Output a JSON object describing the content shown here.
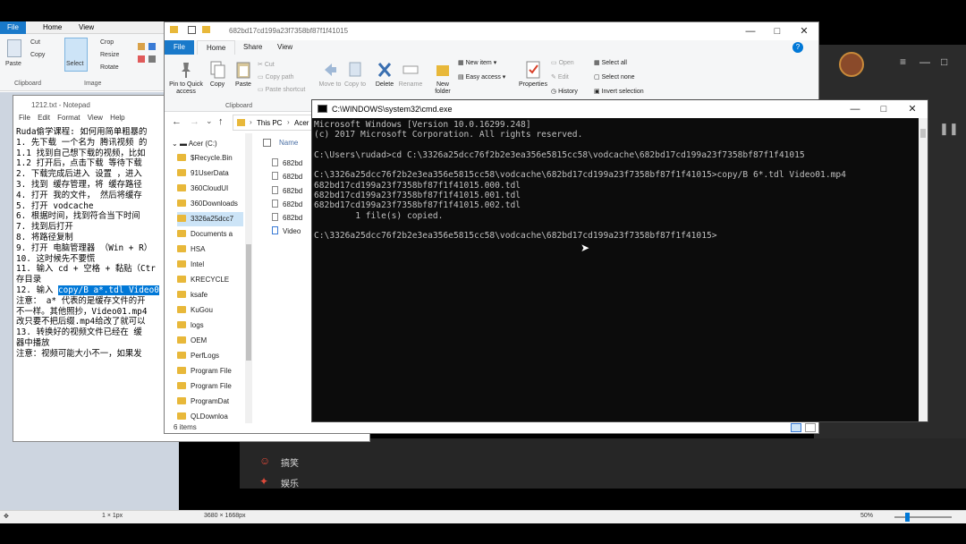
{
  "paint": {
    "tabs": [
      "File",
      "Home",
      "View"
    ],
    "ribbon": {
      "paste": "Paste",
      "cut": "Cut",
      "copy": "Copy",
      "select": "Select",
      "crop": "Crop",
      "resize": "Resize",
      "rotate": "Rotate",
      "group_clipboard": "Clipboard",
      "group_image": "Image"
    },
    "status": {
      "selection": "1 × 1px",
      "size": "3680 × 1668px",
      "zoom": "50%"
    }
  },
  "darkapp": {
    "item1": "搞笑",
    "item2": "娱乐"
  },
  "notepad": {
    "title": "1212.txt - Notepad",
    "menu": [
      "File",
      "Edit",
      "Format",
      "View",
      "Help"
    ],
    "lines": [
      "Ruda偷学课程: 如何用简单粗暴的",
      "",
      "1. 先下载 一个名为 腾讯视频 的",
      "1.1 找到自己想下载的视频，比如",
      "1.2 打开后，点击下载 等待下载",
      "",
      "",
      "2. 下载完成后进入 设置 ，进入",
      "3. 找到 缓存管理，将 缓存路径",
      "4. 打开 我的文件， 然后将缓存",
      "5. 打开 vodcache",
      "6. 根据时间，找到符合当下时间",
      "7. 找到后打开",
      "8. 将路径复制",
      "9. 打开 电脑管理器 （Win + R）",
      "10. 这时候先不要慌",
      "11. 输入 cd + 空格 + 黏贴（Ctr",
      "存目录"
    ],
    "line12_prefix": "12. 输入 ",
    "line12_highlight": "copy/B a*.tdl Video0",
    "lines_after": [
      "",
      "注意： a* 代表的是缓存文件的开",
      "不一样。其他照抄，Video01.mp4",
      "改只要不把后缀.mp4给改了就可以",
      "",
      "13. 转换好的视频文件已经在 缓",
      "器中播放",
      "",
      "注意：视频可能大小不一，如果发"
    ]
  },
  "explorer": {
    "title": "682bd17cd199a23f7358bf87f1f41015",
    "tabs": [
      "File",
      "Home",
      "Share",
      "View"
    ],
    "ribbon": {
      "pin": "Pin to Quick access",
      "copy": "Copy",
      "paste": "Paste",
      "cut": "Cut",
      "copy_path": "Copy path",
      "paste_shortcut": "Paste shortcut",
      "move_to": "Move to",
      "copy_to": "Copy to",
      "delete": "Delete",
      "rename": "Rename",
      "new_folder": "New folder",
      "new_item": "New item",
      "easy_access": "Easy access",
      "properties": "Properties",
      "open": "Open",
      "edit": "Edit",
      "history": "History",
      "select_all": "Select all",
      "select_none": "Select none",
      "invert_selection": "Invert selection",
      "group_clipboard": "Clipboard"
    },
    "address": [
      "This PC",
      "Acer"
    ],
    "nav": [
      "Acer (C:)",
      "$Recycle.Bin",
      "91UserData",
      "360CloudUI",
      "360Downloads",
      "3326a25dcc7",
      "Documents a",
      "HSA",
      "Intel",
      "KRECYCLE",
      "ksafe",
      "KuGou",
      "logs",
      "OEM",
      "PerfLogs",
      "Program File",
      "Program File",
      "ProgramDat",
      "QLDownloa"
    ],
    "column_name": "Name",
    "files": [
      "682bd",
      "682bd",
      "682bd",
      "682bd",
      "682bd",
      "Video"
    ],
    "status": "6 items"
  },
  "cmd": {
    "title": "C:\\WINDOWS\\system32\\cmd.exe",
    "lines": [
      "Microsoft Windows [Version 10.0.16299.248]",
      "(c) 2017 Microsoft Corporation. All rights reserved.",
      "",
      "C:\\Users\\rudad>cd C:\\3326a25dcc76f2b2e3ea356e5815cc58\\vodcache\\682bd17cd199a23f7358bf87f1f41015",
      "",
      "C:\\3326a25dcc76f2b2e3ea356e5815cc58\\vodcache\\682bd17cd199a23f7358bf87f1f41015>copy/B 6*.tdl Video01.mp4",
      "682bd17cd199a23f7358bf87f1f41015.000.tdl",
      "682bd17cd199a23f7358bf87f1f41015.001.tdl",
      "682bd17cd199a23f7358bf87f1f41015.002.tdl",
      "        1 file(s) copied.",
      "",
      "C:\\3326a25dcc76f2b2e3ea356e5815cc58\\vodcache\\682bd17cd199a23f7358bf87f1f41015>"
    ]
  }
}
